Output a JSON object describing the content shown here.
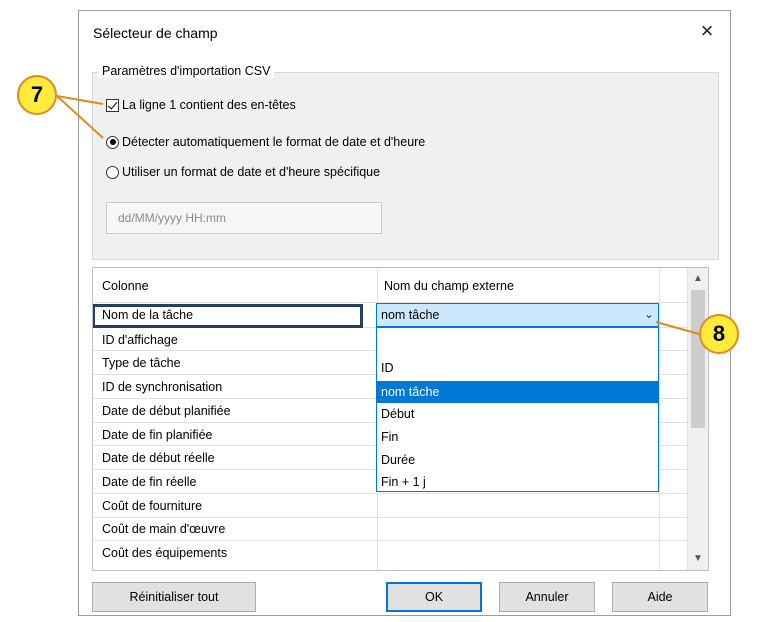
{
  "dialog": {
    "title": "Sélecteur de champ",
    "close_symbol": "×"
  },
  "csv_group": {
    "legend": "Paramètres d'importation CSV",
    "header_checkbox": {
      "label": "La ligne 1 contient des en-têtes",
      "checked": true
    },
    "radio_auto": {
      "label": "Détecter automatiquement le format de date et d'heure",
      "selected": true
    },
    "radio_specific": {
      "label": "Utiliser un format de date et d'heure spécifique",
      "selected": false
    },
    "format_input": {
      "value": "dd/MM/yyyy HH:mm",
      "enabled": false
    }
  },
  "grid": {
    "headers": [
      "Colonne",
      "Nom du champ externe"
    ],
    "rows": [
      "Nom de la tâche",
      "ID d'affichage",
      "Type de tâche",
      "ID de synchronisation",
      "Date de début planifiée",
      "Date de fin planifiée",
      "Date de début réelle",
      "Date de fin réelle",
      "Coût de fourniture",
      "Coût de main d'œuvre",
      "Coût des équipements"
    ],
    "selected_row": "Nom de la tâche",
    "scroll_up_icon": "▲",
    "scroll_down_icon": "▼"
  },
  "combo": {
    "value": "nom tâche",
    "arrow_icon": "chevron-down-icon",
    "options": [
      "",
      "ID",
      "nom tâche",
      "Début",
      "Fin",
      "Durée",
      "Fin + 1 j"
    ],
    "highlighted": "nom tâche"
  },
  "buttons": {
    "reset": "Réinitialiser tout",
    "ok": "OK",
    "cancel": "Annuler",
    "help": "Aide"
  },
  "callouts": {
    "c7": "7",
    "c8": "8"
  },
  "colors": {
    "callout_fill": "#ffeb3b",
    "callout_border": "#e08a1e",
    "selection_blue": "#0078d7",
    "frame_dark": "#243f60"
  }
}
